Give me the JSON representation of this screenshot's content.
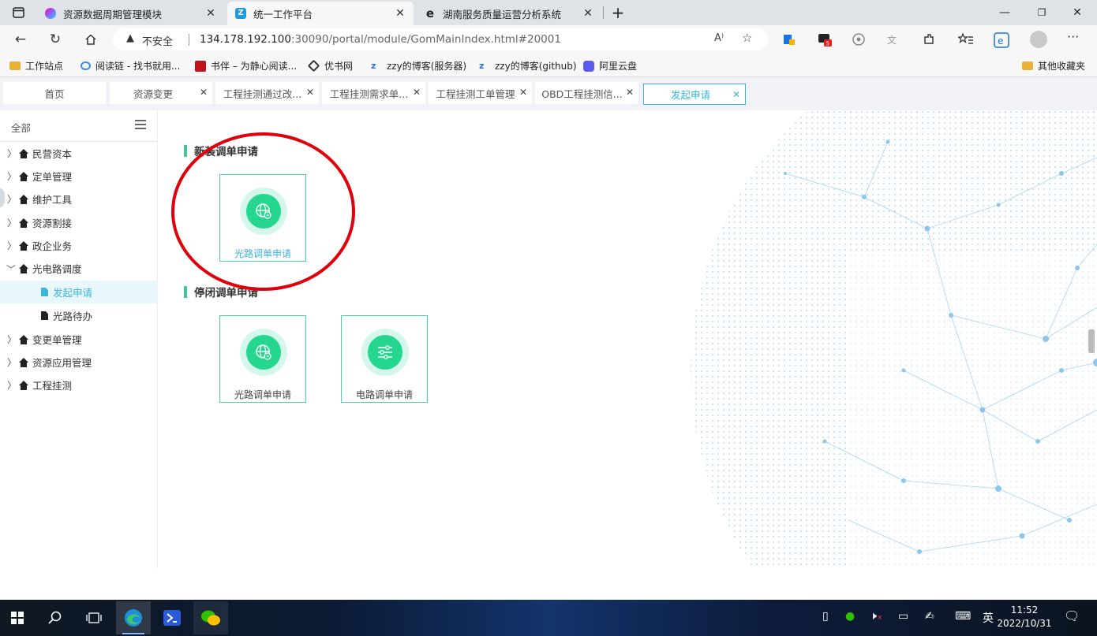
{
  "browser": {
    "tabs": [
      {
        "title": "资源数据周期管理模块",
        "active": false,
        "favicon_color": "#8c5bd9"
      },
      {
        "title": "统一工作平台",
        "active": true,
        "favicon_color": "#1e9be0",
        "favicon_glyph": "Z"
      },
      {
        "title": "湖南服务质量运营分析系统",
        "active": false,
        "favicon_color": "#222222",
        "favicon_glyph": "e"
      }
    ],
    "new_tab_glyph": "+",
    "window_controls": {
      "minimize": "—",
      "maximize": "❐",
      "close": "✕"
    },
    "address": {
      "security_label": "不安全",
      "url_host": "134.178.192.100",
      "url_rest": ":30090/portal/module/GomMainIndex.html#20001",
      "read_aloud_glyph": "A⁾"
    },
    "bookmarks": [
      {
        "label": "工作站点",
        "icon": "folder-icon",
        "color": "#e8b13a"
      },
      {
        "label": "阅读链 - 找书就用...",
        "icon": "link-icon",
        "color": "#3a8ee6"
      },
      {
        "label": "书伴 – 为静心阅读...",
        "icon": "book-icon",
        "color": "#c0141a"
      },
      {
        "label": "优书网",
        "icon": "diamond-icon",
        "color": "#333333"
      },
      {
        "label": "zzy的博客(服务器)",
        "icon": "blog-icon",
        "color": "#2b6fdb"
      },
      {
        "label": "zzy的博客(github)",
        "icon": "blog-icon",
        "color": "#2b6fdb"
      },
      {
        "label": "阿里云盘",
        "icon": "cloud-icon",
        "color": "#5b5bf0"
      }
    ],
    "other_bookmarks": "其他收藏夹"
  },
  "app_tabs": [
    {
      "label": "首页",
      "closable": false,
      "active": false
    },
    {
      "label": "资源变更",
      "closable": true,
      "active": false
    },
    {
      "label": "工程挂测通过改...",
      "closable": true,
      "active": false
    },
    {
      "label": "工程挂测需求单...",
      "closable": true,
      "active": false
    },
    {
      "label": "工程挂测工单管理",
      "closable": true,
      "active": false
    },
    {
      "label": "OBD工程挂测信...",
      "closable": true,
      "active": false
    },
    {
      "label": "发起申请",
      "closable": true,
      "active": true
    }
  ],
  "sidebar": {
    "header": "全部",
    "items": [
      {
        "label": "民营资本",
        "expanded": false
      },
      {
        "label": "定单管理",
        "expanded": false
      },
      {
        "label": "维护工具",
        "expanded": false
      },
      {
        "label": "资源割接",
        "expanded": false
      },
      {
        "label": "政企业务",
        "expanded": false
      },
      {
        "label": "光电路调度",
        "expanded": true
      },
      {
        "label": "发起申请",
        "child": true,
        "selected": true
      },
      {
        "label": "光路待办",
        "child": true,
        "selected": false
      },
      {
        "label": "变更单管理",
        "expanded": false
      },
      {
        "label": "资源应用管理",
        "expanded": false
      },
      {
        "label": "工程挂测",
        "expanded": false
      }
    ]
  },
  "main": {
    "sections": [
      {
        "title": "新装调单申请",
        "cards": [
          {
            "label": "光路调单申请",
            "icon": "globe-icon",
            "highlighted": true
          }
        ]
      },
      {
        "title": "停闭调单申请",
        "cards": [
          {
            "label": "光路调单申请",
            "icon": "globe-icon",
            "highlighted": false
          },
          {
            "label": "电路调单申请",
            "icon": "sliders-icon",
            "highlighted": false
          }
        ]
      }
    ]
  },
  "taskbar": {
    "ime_label": "英",
    "time": "11:52",
    "date": "2022/10/31"
  },
  "colors": {
    "accent": "#3bb6d8",
    "card_green": "#25d68f",
    "section_bar": "#3fc79a",
    "annotation_red": "#e0000b"
  }
}
